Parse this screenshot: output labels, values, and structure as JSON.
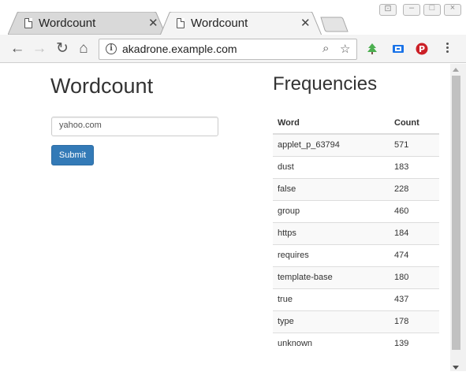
{
  "browser": {
    "tabs": [
      {
        "title": "Wordcount",
        "active": false
      },
      {
        "title": "Wordcount",
        "active": true
      }
    ],
    "address": "akadrone.example.com",
    "window_controls": [
      "minimize",
      "maximize",
      "close"
    ]
  },
  "page": {
    "heading": "Wordcount",
    "input": {
      "value": "",
      "placeholder": "yahoo.com"
    },
    "submit_label": "Submit",
    "frequencies": {
      "heading": "Frequencies",
      "columns": [
        "Word",
        "Count"
      ],
      "rows": [
        {
          "word": "applet_p_63794",
          "count": "571"
        },
        {
          "word": "dust",
          "count": "183"
        },
        {
          "word": "false",
          "count": "228"
        },
        {
          "word": "group",
          "count": "460"
        },
        {
          "word": "https",
          "count": "184"
        },
        {
          "word": "requires",
          "count": "474"
        },
        {
          "word": "template-base",
          "count": "180"
        },
        {
          "word": "true",
          "count": "437"
        },
        {
          "word": "type",
          "count": "178"
        },
        {
          "word": "unknown",
          "count": "139"
        }
      ]
    }
  },
  "colors": {
    "primary_button": "#337ab7",
    "active_tab": "#f4f4f4",
    "inactive_tab": "#d9d9d9",
    "extension_green": "#4caf50",
    "extension_blue": "#1a73e8",
    "pinterest_red": "#cb2027"
  }
}
